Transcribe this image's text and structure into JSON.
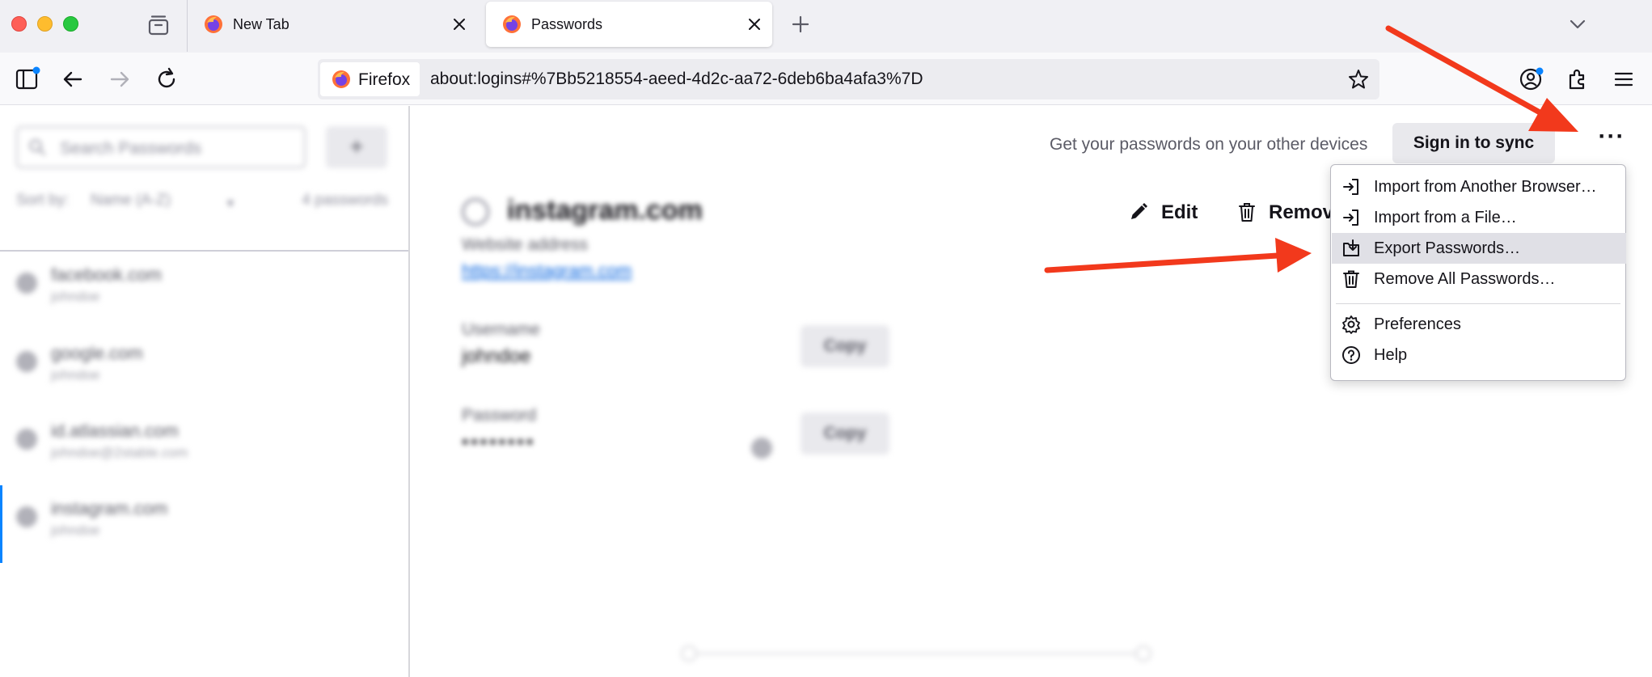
{
  "browser": {
    "tabs": [
      {
        "title": "New Tab",
        "active": false
      },
      {
        "title": "Passwords",
        "active": true
      }
    ],
    "identity_label": "Firefox",
    "url": "about:logins#%7Bb5218554-aeed-4d2c-aa72-6deb6ba4afa3%7D"
  },
  "sidebar": {
    "search_placeholder": "Search Passwords",
    "add_label": "+",
    "sort_label": "Sort by:",
    "sort_value": "Name (A-Z)",
    "count_label": "4 passwords",
    "logins": [
      {
        "origin": "facebook.com",
        "username": "johndoe"
      },
      {
        "origin": "google.com",
        "username": "johndoe"
      },
      {
        "origin": "id.atlassian.com",
        "username": "johndoe@2stable.com"
      },
      {
        "origin": "instagram.com",
        "username": "johndoe"
      }
    ]
  },
  "main": {
    "sync_text": "Get your passwords on your other devices",
    "sync_button": "Sign in to sync",
    "more_button": "···",
    "detail": {
      "title": "instagram.com",
      "edit_label": "Edit",
      "remove_label": "Remove",
      "website_label": "Website address",
      "website_value": "https://instagram.com",
      "username_label": "Username",
      "username_value": "johndoe",
      "password_label": "Password",
      "password_value": "••••••••",
      "copy_label": "Copy"
    }
  },
  "menu": {
    "items": [
      {
        "label": "Import from Another Browser…",
        "icon": "import-icon"
      },
      {
        "label": "Import from a File…",
        "icon": "import-icon"
      },
      {
        "label": "Export Passwords…",
        "icon": "export-icon",
        "highlighted": true
      },
      {
        "label": "Remove All Passwords…",
        "icon": "trash-icon"
      },
      {
        "label": "Preferences",
        "icon": "gear-icon"
      },
      {
        "label": "Help",
        "icon": "help-icon"
      }
    ]
  },
  "colors": {
    "arrow": "#f2391c",
    "link": "#0060df",
    "accent": "#0a84ff"
  }
}
